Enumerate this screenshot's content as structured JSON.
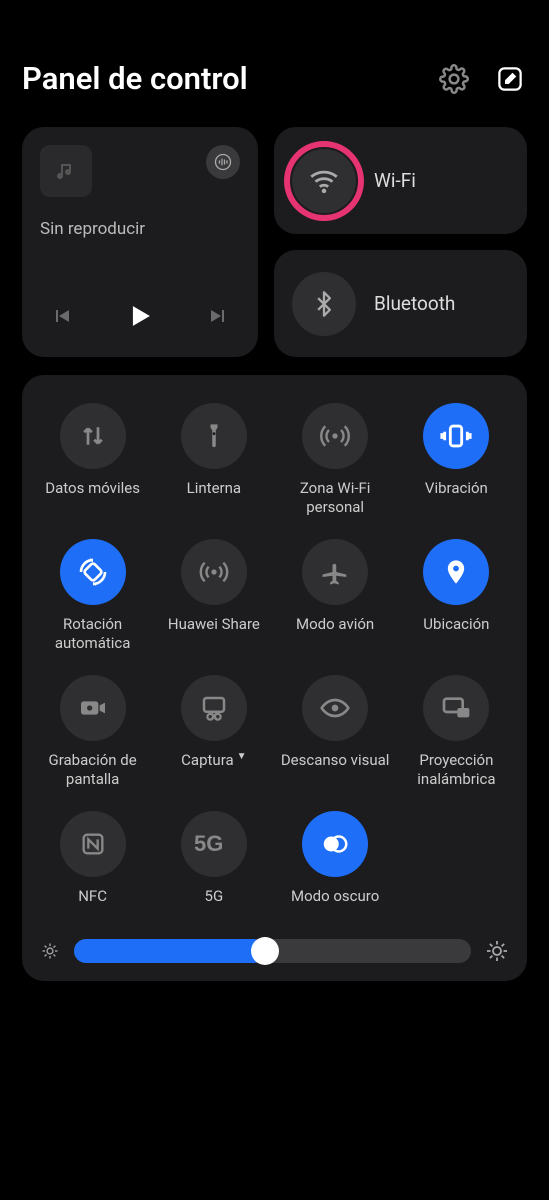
{
  "header": {
    "title": "Panel de control"
  },
  "media": {
    "status": "Sin reproducir"
  },
  "connections": {
    "wifi_label": "Wi-Fi",
    "bluetooth_label": "Bluetooth"
  },
  "tiles": [
    {
      "id": "mobile-data",
      "label": "Datos móviles",
      "icon": "data-arrows",
      "active": false
    },
    {
      "id": "flashlight",
      "label": "Linterna",
      "icon": "flashlight",
      "active": false
    },
    {
      "id": "hotspot",
      "label": "Zona Wi-Fi personal",
      "icon": "hotspot",
      "active": false
    },
    {
      "id": "vibration",
      "label": "Vibración",
      "icon": "vibration",
      "active": true
    },
    {
      "id": "autorotate",
      "label": "Rotación automática",
      "icon": "rotate",
      "active": true
    },
    {
      "id": "huaweishare",
      "label": "Huawei Share",
      "icon": "share-waves",
      "active": false
    },
    {
      "id": "airplane",
      "label": "Modo avión",
      "icon": "airplane",
      "active": false
    },
    {
      "id": "location",
      "label": "Ubicación",
      "icon": "location",
      "active": true
    },
    {
      "id": "screenrec",
      "label": "Grabación de pantalla",
      "icon": "screenrec",
      "active": false
    },
    {
      "id": "screenshot",
      "label": "Captura",
      "icon": "screenshot",
      "active": false,
      "dropdown": true
    },
    {
      "id": "eyecomfort",
      "label": "Descanso visual",
      "icon": "eye",
      "active": false
    },
    {
      "id": "cast",
      "label": "Proyección inalámbrica",
      "icon": "cast",
      "active": false
    },
    {
      "id": "nfc",
      "label": "NFC",
      "icon": "nfc",
      "active": false
    },
    {
      "id": "fiveg",
      "label": "5G",
      "icon": "fiveg",
      "active": false
    },
    {
      "id": "darkmode",
      "label": "Modo oscuro",
      "icon": "darkmode",
      "active": true
    }
  ],
  "brightness": {
    "value": 48,
    "min": 0,
    "max": 100
  },
  "colors": {
    "accent": "#1f6ef7",
    "highlight_ring": "#e63372"
  }
}
